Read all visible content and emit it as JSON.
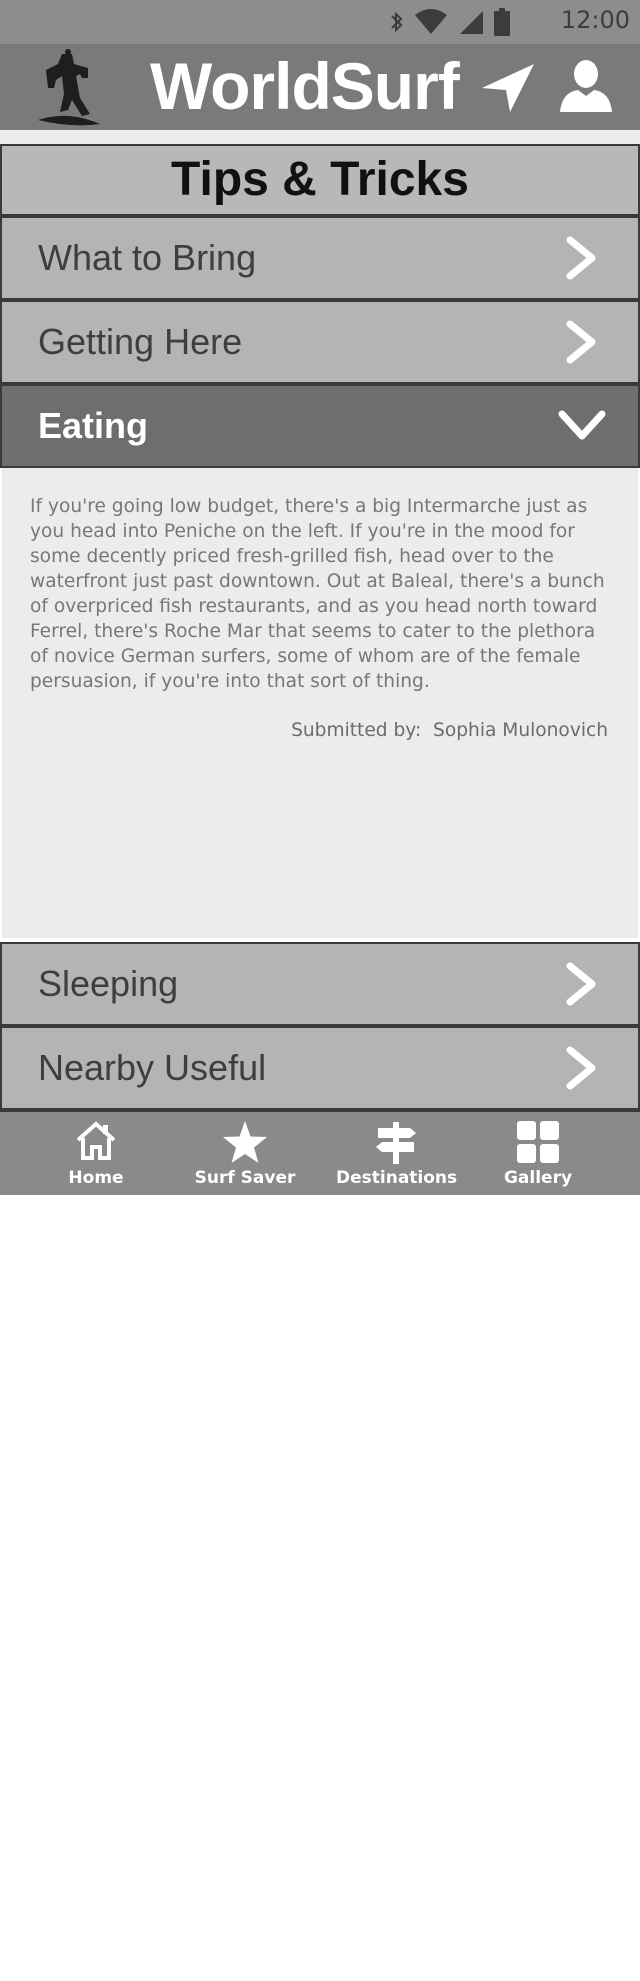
{
  "status_bar": {
    "time": "12:00",
    "icons": [
      "bluetooth-icon",
      "wifi-icon",
      "signal-icon",
      "battery-icon"
    ]
  },
  "header": {
    "title": "WorldSurf",
    "icons": [
      "surfer-logo-icon",
      "navigation-arrow-icon",
      "user-icon"
    ]
  },
  "page": {
    "title": "Tips & Tricks"
  },
  "sections": [
    {
      "label": "What to Bring",
      "state": "collapsed"
    },
    {
      "label": "Getting Here",
      "state": "collapsed"
    },
    {
      "label": "Eating",
      "state": "expanded"
    },
    {
      "label": "Sleeping",
      "state": "collapsed"
    },
    {
      "label": "Nearby Useful",
      "state": "collapsed"
    }
  ],
  "expanded": {
    "body": "If you're going low budget, there's a big Intermarche just as you head into Peniche on the left. If you're in the mood for some decently priced fresh-grilled fish, head over to the waterfront just past downtown. Out at Baleal, there's a bunch of overpriced fish restaurants, and as you head north toward Ferrel, there's Roche Mar that seems to cater to the plethora of novice German surfers, some of whom are of the female persuasion, if you're into that sort of thing.",
    "submitted_label": "Submitted by:",
    "submitted_name": "Sophia Mulonovich"
  },
  "bottom_nav": [
    {
      "label": "Home",
      "icon": "home-icon"
    },
    {
      "label": "Surf Saver",
      "icon": "star-icon"
    },
    {
      "label": "Destinations",
      "icon": "signpost-icon"
    },
    {
      "label": "Gallery",
      "icon": "grid-icon"
    }
  ],
  "colors": {
    "status_bar": "#8d8d8d",
    "header": "#7a7a7a",
    "row": "#b4b4b4",
    "row_open": "#6e6e6e",
    "content_bg": "#ececec",
    "nav_bg": "#8a8a8a"
  }
}
